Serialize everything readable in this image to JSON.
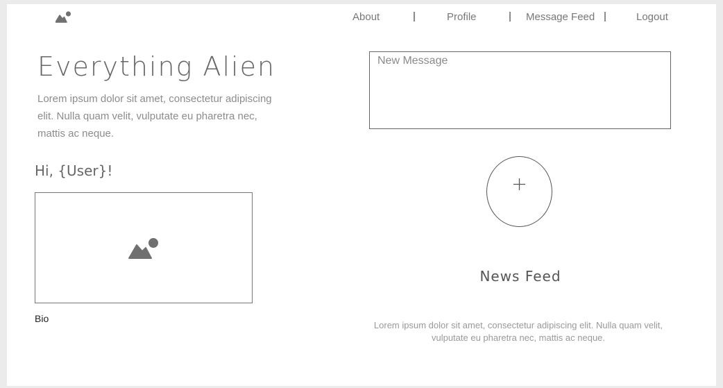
{
  "nav": {
    "logo_icon": "image-icon",
    "links": [
      "About",
      "Profile",
      "Message Feed",
      "Logout"
    ]
  },
  "hero": {
    "title": "Everything Alien",
    "intro": "Lorem ipsum dolor sit amet, consectetur adipiscing elit. Nulla quam velit, vulputate eu pharetra nec, mattis ac neque."
  },
  "profile": {
    "greeting": "Hi, {User}!",
    "photo_icon": "image-icon",
    "bio_label": "Bio"
  },
  "composer": {
    "placeholder": "New Message",
    "add_icon": "plus-icon"
  },
  "feed": {
    "title": "News Feed",
    "text": "Lorem ipsum dolor sit amet, consectetur adipiscing elit. Nulla quam velit, vulputate eu pharetra nec, mattis ac neque."
  },
  "colors": {
    "icon": "#707070",
    "text_muted": "#8c8c8c",
    "border": "#666666"
  }
}
